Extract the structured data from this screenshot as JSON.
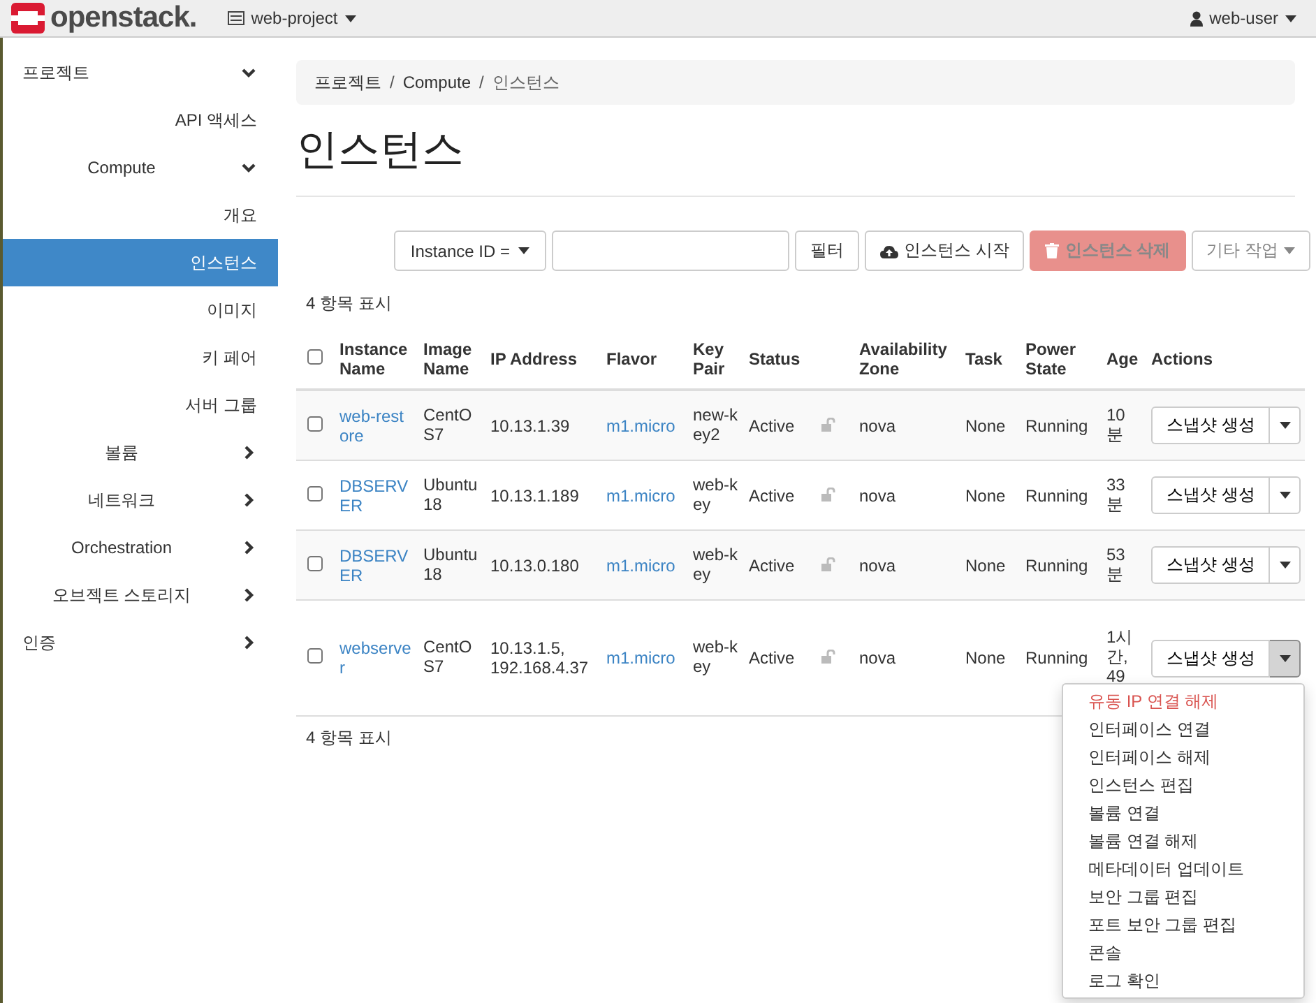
{
  "topbar": {
    "logo": "openstack.",
    "project": "web-project",
    "user": "web-user"
  },
  "sidebar": [
    {
      "label": "프로젝트",
      "expanded": true,
      "children": [
        {
          "label": "API 액세스",
          "selected": false
        },
        {
          "label": "Compute",
          "expanded": true,
          "children": [
            {
              "label": "개요",
              "selected": false
            },
            {
              "label": "인스턴스",
              "selected": true
            },
            {
              "label": "이미지",
              "selected": false
            },
            {
              "label": "키 페어",
              "selected": false
            },
            {
              "label": "서버 그룹",
              "selected": false
            }
          ]
        },
        {
          "label": "볼륨",
          "expanded": false
        },
        {
          "label": "네트워크",
          "expanded": false
        },
        {
          "label": "Orchestration",
          "expanded": false
        },
        {
          "label": "오브젝트 스토리지",
          "expanded": false
        }
      ]
    },
    {
      "label": "인증",
      "expanded": false
    }
  ],
  "breadcrumb": {
    "items": [
      "프로젝트",
      "Compute",
      "인스턴스"
    ],
    "separator": "/"
  },
  "page_title": "인스턴스",
  "toolbar": {
    "filter_select": "Instance ID =",
    "buttons": [
      {
        "kind": "default",
        "label": "필터",
        "disabled": false
      },
      {
        "kind": "launch",
        "label": "인스턴스 시작",
        "disabled": false
      },
      {
        "kind": "delete",
        "label": "인스턴스 삭제",
        "disabled": true
      },
      {
        "kind": "more",
        "label": "기타 작업",
        "disabled": true
      }
    ]
  },
  "count_top": "4 항목 표시",
  "table": {
    "select_all": {
      "checked": false
    },
    "columns": [
      "Instance Name",
      "Image Name",
      "IP Address",
      "Flavor",
      "Key Pair",
      "Status",
      "Availability Zone",
      "Task",
      "Power State",
      "Age",
      "Actions"
    ],
    "rows": [
      {
        "checked": false,
        "name": "web-restore",
        "image": "CentOS7",
        "ip": "10.13.1.39",
        "flavor": "m1.micro",
        "key": "new-key2",
        "status": "Active",
        "az": "nova",
        "task": "None",
        "power": "Running",
        "age": "10분",
        "action": "스냅샷 생성",
        "menu_open": false
      },
      {
        "checked": false,
        "name": "DBSERVER",
        "image": "Ubuntu18",
        "ip": "10.13.1.189",
        "flavor": "m1.micro",
        "key": "web-key",
        "status": "Active",
        "az": "nova",
        "task": "None",
        "power": "Running",
        "age": "33분",
        "action": "스냅샷 생성",
        "menu_open": false
      },
      {
        "checked": false,
        "name": "DBSERVER",
        "image": "Ubuntu18",
        "ip": "10.13.0.180",
        "flavor": "m1.micro",
        "key": "web-key",
        "status": "Active",
        "az": "nova",
        "task": "None",
        "power": "Running",
        "age": "53분",
        "action": "스냅샷 생성",
        "menu_open": false
      },
      {
        "checked": false,
        "name": "webserver",
        "image": "CentOS7",
        "ip": "10.13.1.5, 192.168.4.37",
        "flavor": "m1.micro",
        "key": "web-key",
        "status": "Active",
        "az": "nova",
        "task": "None",
        "power": "Running",
        "age": "1시간, 49",
        "action": "스냅샷 생성",
        "menu_open": true
      }
    ]
  },
  "action_menu": [
    {
      "label": "유동 IP 연결 해제",
      "kind": "danger"
    },
    {
      "label": "인터페이스 연결",
      "kind": "normal"
    },
    {
      "label": "인터페이스 해제",
      "kind": "normal"
    },
    {
      "label": "인스턴스 편집",
      "kind": "normal"
    },
    {
      "label": "볼륨 연결",
      "kind": "normal"
    },
    {
      "label": "볼륨 연결 해제",
      "kind": "normal"
    },
    {
      "label": "메타데이터 업데이트",
      "kind": "normal"
    },
    {
      "label": "보안 그룹 편집",
      "kind": "normal"
    },
    {
      "label": "포트 보안 그룹 편집",
      "kind": "normal"
    },
    {
      "label": "콘솔",
      "kind": "normal"
    },
    {
      "label": "로그 확인",
      "kind": "normal"
    }
  ],
  "count_bottom": "4 항목 표시"
}
